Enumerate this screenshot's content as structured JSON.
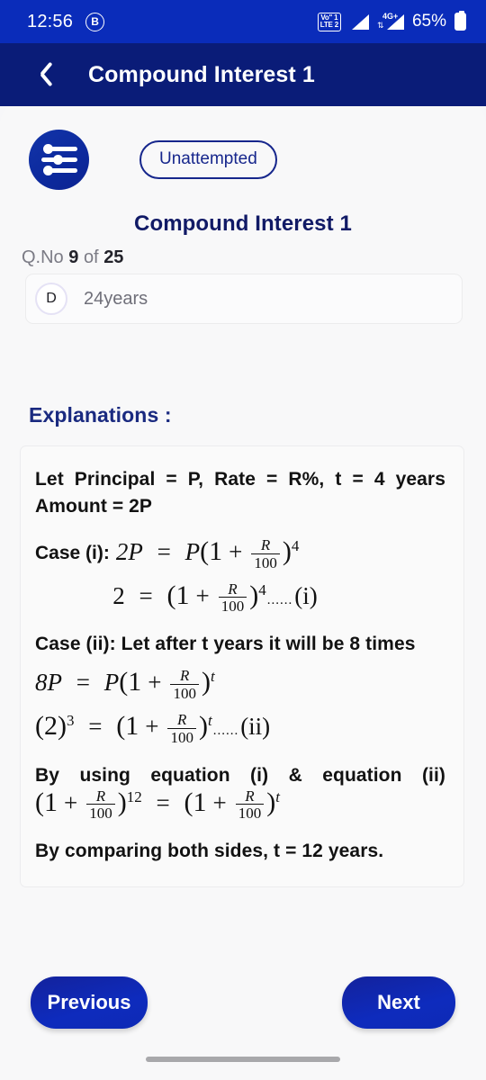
{
  "status_bar": {
    "time": "12:56",
    "bluetooth_badge": "B",
    "volte_line1": "Vo\" 1",
    "volte_line2": "LTE 2",
    "network_type": "4G+",
    "battery_percent": "65%",
    "icons": [
      "bluetooth-icon",
      "volte-icon",
      "signal-icon",
      "signal-secondary-icon",
      "battery-icon"
    ],
    "bg_color": "#0a2cba"
  },
  "app_bar": {
    "title": "Compound Interest 1",
    "back_icon": "chevron-left-icon",
    "bg_color": "#0a1c78"
  },
  "question_card": {
    "avatar_icon": "sliders-icon",
    "status_badge": "Unattempted",
    "title": "Compound Interest 1",
    "qno_prefix": "Q.No",
    "qno_current": "9",
    "qno_of": "of",
    "qno_total": "25",
    "option": {
      "letter": "D",
      "text": "24years"
    },
    "accent_color": "#16268c"
  },
  "explanations": {
    "heading": "Explanations :",
    "line_1": "Let  Principal  =  P,  Rate  =  R%,  t  =  4  years",
    "line_2": "Amount = 2P",
    "case1_label": "Case (i):",
    "case1_eq": "2P = P(1 + R/100)^4",
    "case1_eq_parts": {
      "lhs": "2P",
      "eq": "=",
      "p": "P",
      "one": "(1",
      "plus": "+",
      "num": "R",
      "den": "100",
      "close": ")",
      "exp": "4"
    },
    "eq_i": {
      "lhs": "2",
      "eq": "=",
      "one": "(1",
      "plus": "+",
      "num": "R",
      "den": "100",
      "close": ")",
      "exp": "4",
      "dots": "......",
      "tag": "(i)"
    },
    "case2_label": "Case (ii): Let after t years it will be 8 times",
    "case2_eq": {
      "lhs": "8P",
      "eq": "=",
      "p": "P",
      "one": "(1",
      "plus": "+",
      "num": "R",
      "den": "100",
      "close": ")",
      "exp": "t"
    },
    "eq_ii": {
      "lhs_open": "(2)",
      "lhs_exp": "3",
      "eq": "=",
      "one": "(1",
      "plus": "+",
      "num": "R",
      "den": "100",
      "close": ")",
      "exp": "t",
      "dots": "......",
      "tag": "(ii)"
    },
    "using_line": "By  using  equation  (i)  &  equation  (ii)",
    "final_eq": {
      "l_one": "(1",
      "l_plus": "+",
      "l_num": "R",
      "l_den": "100",
      "l_close": ")",
      "l_exp": "12",
      "eq": "=",
      "r_one": "(1",
      "r_plus": "+",
      "r_num": "R",
      "r_den": "100",
      "r_close": ")",
      "r_exp": "t"
    },
    "conclusion": "By comparing both sides, t = 12 years."
  },
  "footer": {
    "previous_label": "Previous",
    "next_label": "Next",
    "button_color": "#0e2bbd"
  }
}
